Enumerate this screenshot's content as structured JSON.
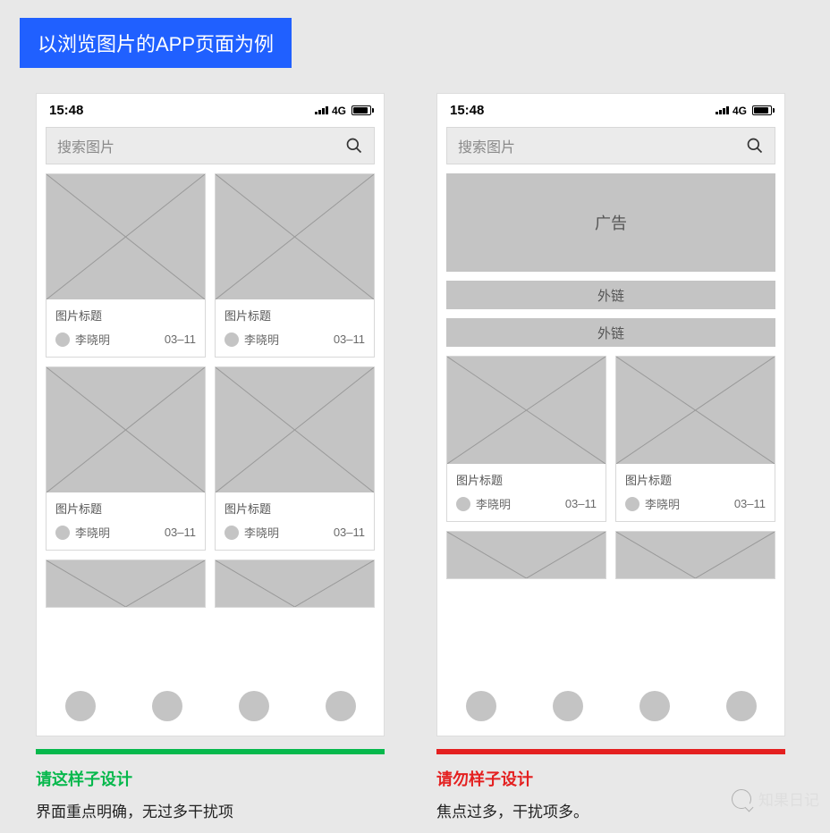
{
  "header": {
    "title": "以浏览图片的APP页面为例"
  },
  "phoneA": {
    "status": {
      "time": "15:48",
      "net": "4G"
    },
    "search": {
      "placeholder": "搜索图片"
    },
    "cards": [
      {
        "title": "图片标题",
        "author": "李晓明",
        "date": "03–11"
      },
      {
        "title": "图片标题",
        "author": "李晓明",
        "date": "03–11"
      },
      {
        "title": "图片标题",
        "author": "李晓明",
        "date": "03–11"
      },
      {
        "title": "图片标题",
        "author": "李晓明",
        "date": "03–11"
      }
    ]
  },
  "phoneB": {
    "status": {
      "time": "15:48",
      "net": "4G"
    },
    "search": {
      "placeholder": "搜索图片"
    },
    "banner": "广告",
    "link1": "外链",
    "link2": "外链",
    "cards": [
      {
        "title": "图片标题",
        "author": "李晓明",
        "date": "03–11"
      },
      {
        "title": "图片标题",
        "author": "李晓明",
        "date": "03–11"
      }
    ]
  },
  "captionA": {
    "title": "请这样子设计",
    "desc": "界面重点明确，无过多干扰项"
  },
  "captionB": {
    "title": "请勿样子设计",
    "desc": "焦点过多，干扰项多。"
  },
  "brand": "知果日记"
}
